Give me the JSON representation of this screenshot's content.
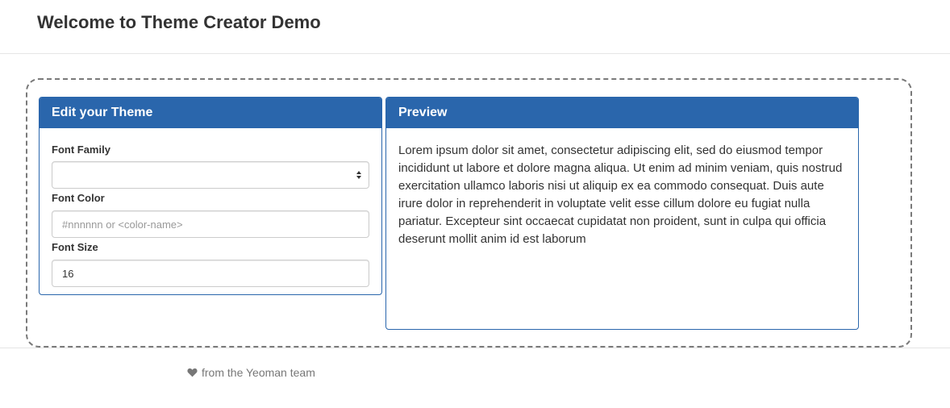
{
  "header": {
    "title": "Welcome to Theme Creator Demo"
  },
  "editor": {
    "heading": "Edit your Theme",
    "font_family": {
      "label": "Font Family",
      "value": ""
    },
    "font_color": {
      "label": "Font Color",
      "value": "",
      "placeholder": "#nnnnnn or <color-name>"
    },
    "font_size": {
      "label": "Font Size",
      "value": "16"
    }
  },
  "preview": {
    "heading": "Preview",
    "text": "Lorem ipsum dolor sit amet, consectetur adipiscing elit, sed do eiusmod tempor incididunt ut labore et dolore magna aliqua. Ut enim ad minim veniam, quis nostrud exercitation ullamco laboris nisi ut aliquip ex ea commodo consequat. Duis aute irure dolor in reprehenderit in voluptate velit esse cillum dolore eu fugiat nulla pariatur. Excepteur sint occaecat cupidatat non proident, sunt in culpa qui officia deserunt mollit anim id est laborum"
  },
  "footer": {
    "text": "from the Yeoman team",
    "icon": "heart-icon"
  },
  "colors": {
    "panel_primary": "#2a66ac",
    "dashed_border": "#7a7a7a"
  }
}
